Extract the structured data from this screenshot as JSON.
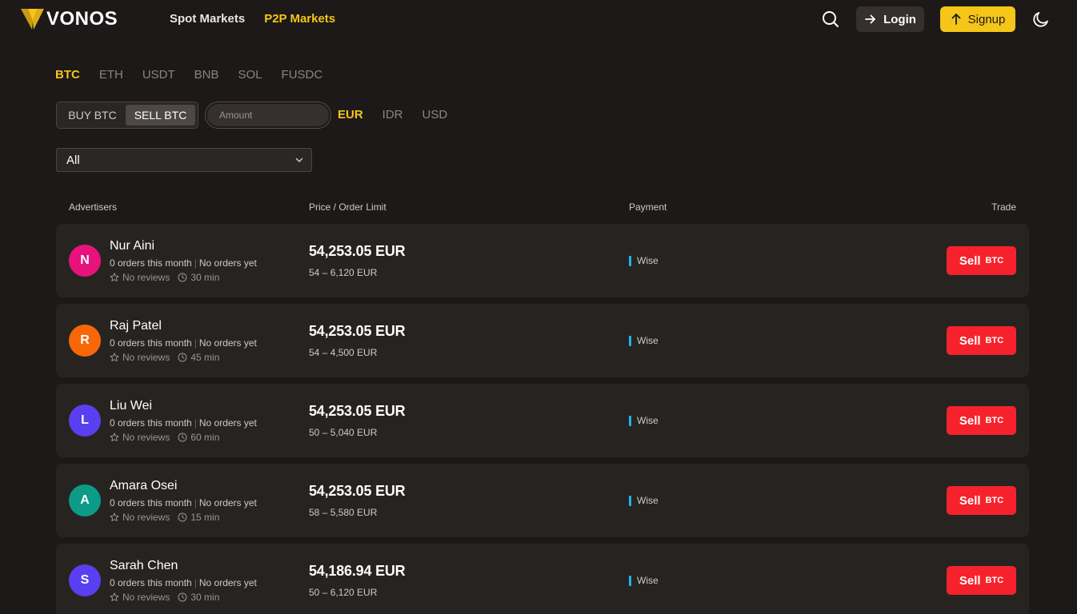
{
  "brand": {
    "name": "VONOS",
    "accent": "#f5c518"
  },
  "nav": {
    "items": [
      "Spot Markets",
      "P2P Markets"
    ],
    "active": "P2P Markets"
  },
  "header": {
    "login_label": "Login",
    "signup_label": "Signup"
  },
  "coins": [
    "BTC",
    "ETH",
    "USDT",
    "BNB",
    "SOL",
    "FUSDC"
  ],
  "toggle": {
    "buy_label": "BUY BTC",
    "sell_label": "SELL BTC"
  },
  "amount": {
    "placeholder": "Amount",
    "value": ""
  },
  "fiats": [
    "EUR",
    "IDR",
    "USD"
  ],
  "filter": {
    "selected": "All"
  },
  "table": {
    "headers": {
      "advertisers": "Advertisers",
      "price": "Price / Order Limit",
      "payment": "Payment",
      "trade": "Trade"
    },
    "rows": [
      {
        "initial": "N",
        "avatar_color": "#e8127c",
        "name": "Nur Aini",
        "orders": "0 orders this month",
        "completion": "No orders yet",
        "reviews": "No reviews",
        "time": "30 min",
        "price": "54,253.05 EUR",
        "limit": "54 – 6,120 EUR",
        "payment": "Wise",
        "action": "Sell",
        "coin": "BTC"
      },
      {
        "initial": "R",
        "avatar_color": "#f76707",
        "name": "Raj Patel",
        "orders": "0 orders this month",
        "completion": "No orders yet",
        "reviews": "No reviews",
        "time": "45 min",
        "price": "54,253.05 EUR",
        "limit": "54 – 4,500 EUR",
        "payment": "Wise",
        "action": "Sell",
        "coin": "BTC"
      },
      {
        "initial": "L",
        "avatar_color": "#5a3ff0",
        "name": "Liu Wei",
        "orders": "0 orders this month",
        "completion": "No orders yet",
        "reviews": "No reviews",
        "time": "60 min",
        "price": "54,253.05 EUR",
        "limit": "50 – 5,040 EUR",
        "payment": "Wise",
        "action": "Sell",
        "coin": "BTC"
      },
      {
        "initial": "A",
        "avatar_color": "#0c9b86",
        "name": "Amara Osei",
        "orders": "0 orders this month",
        "completion": "No orders yet",
        "reviews": "No reviews",
        "time": "15 min",
        "price": "54,253.05 EUR",
        "limit": "58 – 5,580 EUR",
        "payment": "Wise",
        "action": "Sell",
        "coin": "BTC"
      },
      {
        "initial": "S",
        "avatar_color": "#5a3ff0",
        "name": "Sarah Chen",
        "orders": "0 orders this month",
        "completion": "No orders yet",
        "reviews": "No reviews",
        "time": "30 min",
        "price": "54,186.94 EUR",
        "limit": "50 – 6,120 EUR",
        "payment": "Wise",
        "action": "Sell",
        "coin": "BTC"
      }
    ]
  }
}
